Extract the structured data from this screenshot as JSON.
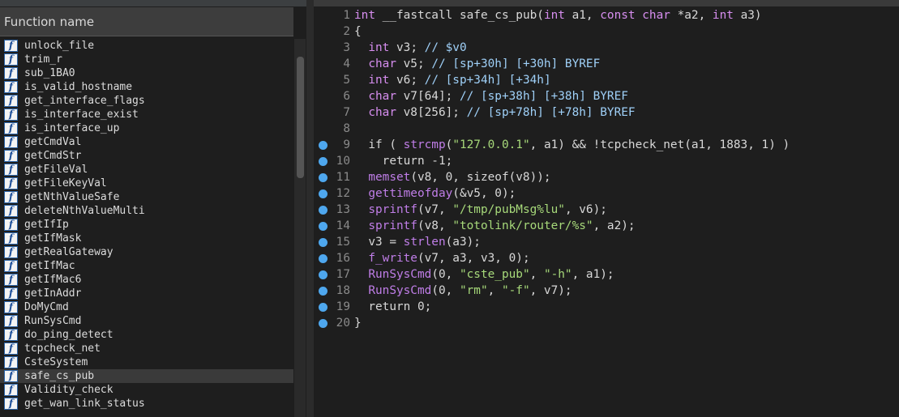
{
  "functions_pane": {
    "header": "Function name",
    "items": [
      "unlock_file",
      "trim_r",
      "sub_1BA0",
      "is_valid_hostname",
      "get_interface_flags",
      "is_interface_exist",
      "is_interface_up",
      "getCmdVal",
      "getCmdStr",
      "getFileVal",
      "getFileKeyVal",
      "getNthValueSafe",
      "deleteNthValueMulti",
      "getIfIp",
      "getIfMask",
      "getRealGateway",
      "getIfMac",
      "getIfMac6",
      "getInAddr",
      "DoMyCmd",
      "RunSysCmd",
      "do_ping_detect",
      "tcpcheck_net",
      "CsteSystem",
      "safe_cs_pub",
      "Validity_check",
      "get_wan_link_status"
    ],
    "selected": "safe_cs_pub",
    "icon_glyph": "f"
  },
  "code_view": {
    "lines": [
      {
        "n": "1",
        "bp": false,
        "text": "int __fastcall safe_cs_pub(int a1, const char *a2, int a3)"
      },
      {
        "n": "2",
        "bp": false,
        "text": "{"
      },
      {
        "n": "3",
        "bp": false,
        "text": "  int v3; // $v0"
      },
      {
        "n": "4",
        "bp": false,
        "text": "  char v5; // [sp+30h] [+30h] BYREF"
      },
      {
        "n": "5",
        "bp": false,
        "text": "  int v6; // [sp+34h] [+34h]"
      },
      {
        "n": "6",
        "bp": false,
        "text": "  char v7[64]; // [sp+38h] [+38h] BYREF"
      },
      {
        "n": "7",
        "bp": false,
        "text": "  char v8[256]; // [sp+78h] [+78h] BYREF"
      },
      {
        "n": "8",
        "bp": false,
        "text": ""
      },
      {
        "n": "9",
        "bp": true,
        "text": "  if ( strcmp(\"127.0.0.1\", a1) && !tcpcheck_net(a1, 1883, 1) )"
      },
      {
        "n": "10",
        "bp": true,
        "text": "    return -1;"
      },
      {
        "n": "11",
        "bp": true,
        "text": "  memset(v8, 0, sizeof(v8));"
      },
      {
        "n": "12",
        "bp": true,
        "text": "  gettimeofday(&v5, 0);"
      },
      {
        "n": "13",
        "bp": true,
        "text": "  sprintf(v7, \"/tmp/pubMsg%lu\", v6);"
      },
      {
        "n": "14",
        "bp": true,
        "text": "  sprintf(v8, \"totolink/router/%s\", a2);"
      },
      {
        "n": "15",
        "bp": true,
        "text": "  v3 = strlen(a3);"
      },
      {
        "n": "16",
        "bp": true,
        "text": "  f_write(v7, a3, v3, 0);"
      },
      {
        "n": "17",
        "bp": true,
        "text": "  RunSysCmd(0, \"cste_pub\", \"-h\", a1);"
      },
      {
        "n": "18",
        "bp": true,
        "text": "  RunSysCmd(0, \"rm\", \"-f\", v7);"
      },
      {
        "n": "19",
        "bp": true,
        "text": "  return 0;"
      },
      {
        "n": "20",
        "bp": true,
        "text": "}"
      }
    ]
  },
  "colors": {
    "background": "#1e1e1e",
    "type_keyword": "#d78ef0",
    "function_call": "#c07ee8",
    "string_literal": "#a7d97a",
    "comment": "#9fd0f8",
    "breakpoint_dot": "#4ea7ee",
    "selected_row": "#3a3a3a"
  }
}
